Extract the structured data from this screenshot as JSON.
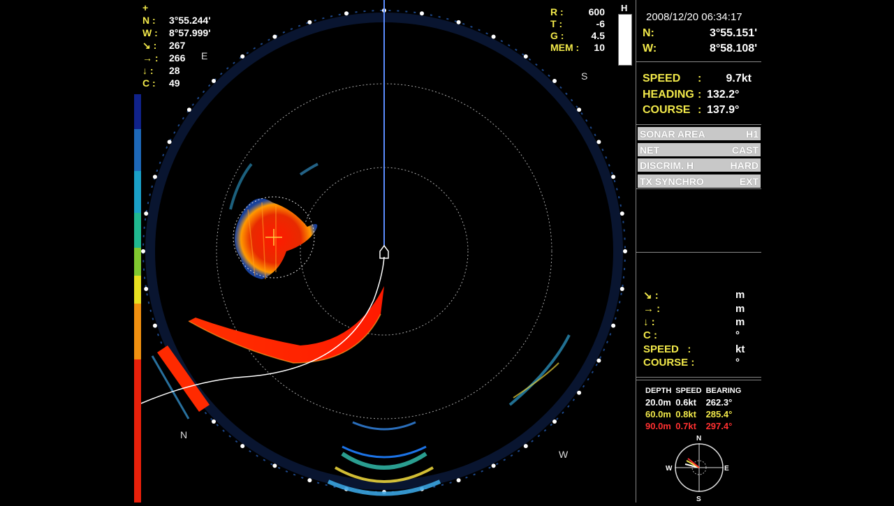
{
  "left_readout": {
    "cursor_symbol": "+",
    "rows": [
      {
        "key": "N :",
        "value": "3°55.244'"
      },
      {
        "key": "W :",
        "value": "8°57.999'"
      },
      {
        "key": "↘ :",
        "value": "267"
      },
      {
        "key": "→ :",
        "value": "266"
      },
      {
        "key": "↓ :",
        "value": "28"
      },
      {
        "key": "C :",
        "value": "49"
      }
    ]
  },
  "rtg": {
    "rows": [
      {
        "key": "R :",
        "value": "600"
      },
      {
        "key": "T :",
        "value": "-6"
      },
      {
        "key": "G :",
        "value": "4.5"
      },
      {
        "key": "MEM :",
        "value": "10"
      }
    ],
    "h_label": "H"
  },
  "compass_labels": {
    "e": "E",
    "s": "S",
    "n": "N",
    "w": "W"
  },
  "position_box": {
    "datetime": "2008/12/20 06:34:17",
    "lat_key": "N:",
    "lat_value": "3°55.151'",
    "lon_key": "W:",
    "lon_value": "8°58.108'"
  },
  "nav_box": {
    "speed_key": "SPEED",
    "speed_value": "9.7kt",
    "heading_key": "HEADING",
    "heading_value": "132.2°",
    "course_key": "COURSE",
    "course_value": "137.9°",
    "sep": ":"
  },
  "menu": [
    {
      "label": "SONAR AREA",
      "value": "H1"
    },
    {
      "label": "NET",
      "value": "CAST"
    },
    {
      "label": "DISCRIM. H",
      "value": "HARD"
    },
    {
      "label": "TX SYNCHRO",
      "value": "EXT"
    }
  ],
  "target_box": {
    "rows": [
      {
        "key": "↘ :",
        "unit": "m"
      },
      {
        "key": "→ :",
        "unit": "m"
      },
      {
        "key": "↓ :",
        "unit": "m"
      },
      {
        "key": "C :",
        "unit": "°"
      },
      {
        "key": "SPEED   :",
        "unit": "kt"
      },
      {
        "key": "COURSE :",
        "unit": "°"
      }
    ]
  },
  "current_table": {
    "headers": [
      "DEPTH",
      "SPEED",
      "BEARING"
    ],
    "rows": [
      {
        "depth": "20.0m",
        "speed": "0.6kt",
        "bearing": "262.3°",
        "color": "#ffffff"
      },
      {
        "depth": "60.0m",
        "speed": "0.8kt",
        "bearing": "285.4°",
        "color": "#f2e94a"
      },
      {
        "depth": "90.0m",
        "speed": "0.7kt",
        "bearing": "297.4°",
        "color": "#ff3030"
      }
    ]
  },
  "current_rose": {
    "n": "N",
    "s": "S",
    "e": "E",
    "w": "W"
  },
  "colors": {
    "accent_yellow": "#f2e94a",
    "echo_red": "#e8200a",
    "panel_button": "#c8c8c8"
  }
}
